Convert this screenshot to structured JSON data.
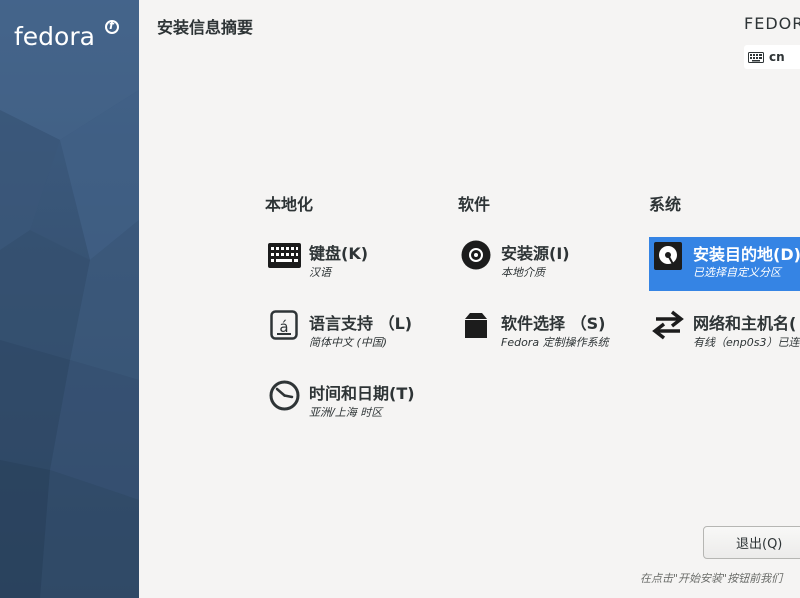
{
  "header": {
    "title": "安装信息摘要",
    "product": "FEDOR",
    "keyboard_layout": "cn"
  },
  "sidebar": {
    "logo_text": "fedora",
    "logo_mark": "f"
  },
  "sections": [
    {
      "title": "本地化",
      "spokes": [
        {
          "icon": "keyboard-icon",
          "label": "键盘(K)",
          "status": "汉语"
        },
        {
          "icon": "language-icon",
          "label": "语言支持 （L)",
          "status": "简体中文 (中国)"
        },
        {
          "icon": "clock-icon",
          "label": "时间和日期(T)",
          "status": "亚洲/上海 时区"
        }
      ]
    },
    {
      "title": "软件",
      "spokes": [
        {
          "icon": "disc-icon",
          "label": "安装源(I)",
          "status": "本地介质"
        },
        {
          "icon": "package-icon",
          "label": "软件选择 （S)",
          "status": "Fedora 定制操作系统"
        }
      ]
    },
    {
      "title": "系统",
      "spokes": [
        {
          "icon": "harddisk-icon",
          "label": "安装目的地(D)",
          "status": "已选择自定义分区",
          "selected": true
        },
        {
          "icon": "network-arrows-icon",
          "label": "网络和主机名(",
          "status": "有线（enp0s3）已连"
        }
      ]
    }
  ],
  "footer": {
    "quit_label": "退出(Q)",
    "hint": "在点击\"开始安装\"按钮前我们"
  },
  "colors": {
    "sidebar": "#3f5f86",
    "background": "#f5f4f3",
    "selected": "#3584e4",
    "text": "#2e3436"
  }
}
